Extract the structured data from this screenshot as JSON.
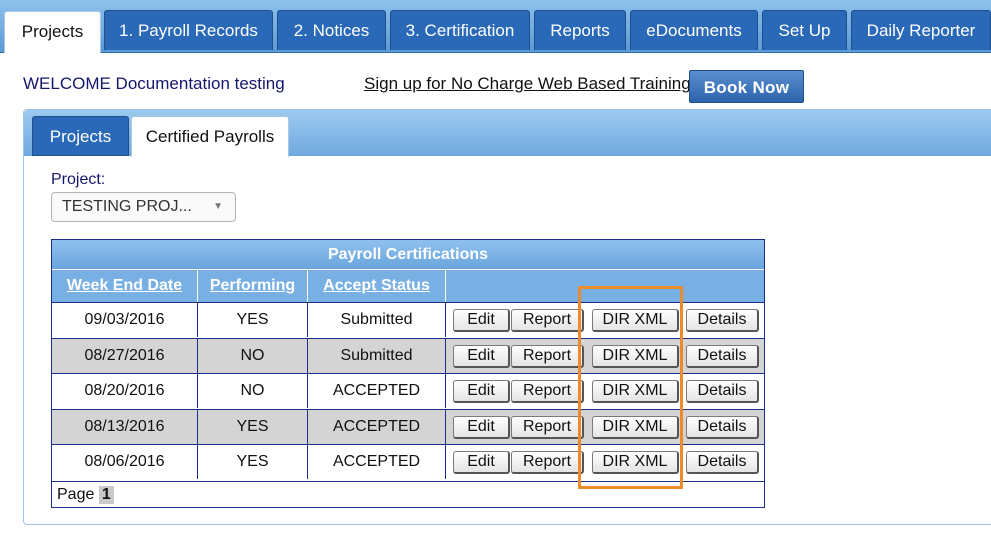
{
  "top_tabs": [
    "Projects",
    "1. Payroll Records",
    "2. Notices",
    "3. Certification",
    "Reports",
    "eDocuments",
    "Set Up",
    "Daily Reporter"
  ],
  "welcome_text": "WELCOME Documentation testing",
  "training_link": "Sign up for No Charge Web Based Training",
  "book_now": "Book Now",
  "sub_tabs": [
    "Projects",
    "Certified Payrolls"
  ],
  "project_label": "Project:",
  "project_select_value": "TESTING PROJ...",
  "grid": {
    "title": "Payroll Certifications",
    "headers": [
      "Week End Date",
      "Performing",
      "Accept Status"
    ],
    "buttons": [
      "Edit",
      "Report",
      "DIR XML",
      "Details"
    ],
    "rows": [
      {
        "date": "09/03/2016",
        "performing": "YES",
        "status": "Submitted"
      },
      {
        "date": "08/27/2016",
        "performing": "NO",
        "status": "Submitted"
      },
      {
        "date": "08/20/2016",
        "performing": "NO",
        "status": "ACCEPTED"
      },
      {
        "date": "08/13/2016",
        "performing": "YES",
        "status": "ACCEPTED"
      },
      {
        "date": "08/06/2016",
        "performing": "YES",
        "status": "ACCEPTED"
      }
    ],
    "page_label": "Page",
    "page_number": "1"
  },
  "colors": {
    "nav_blue": "#2a69b8",
    "highlight_orange": "#ec8a2e",
    "text_navy": "#15166e"
  }
}
